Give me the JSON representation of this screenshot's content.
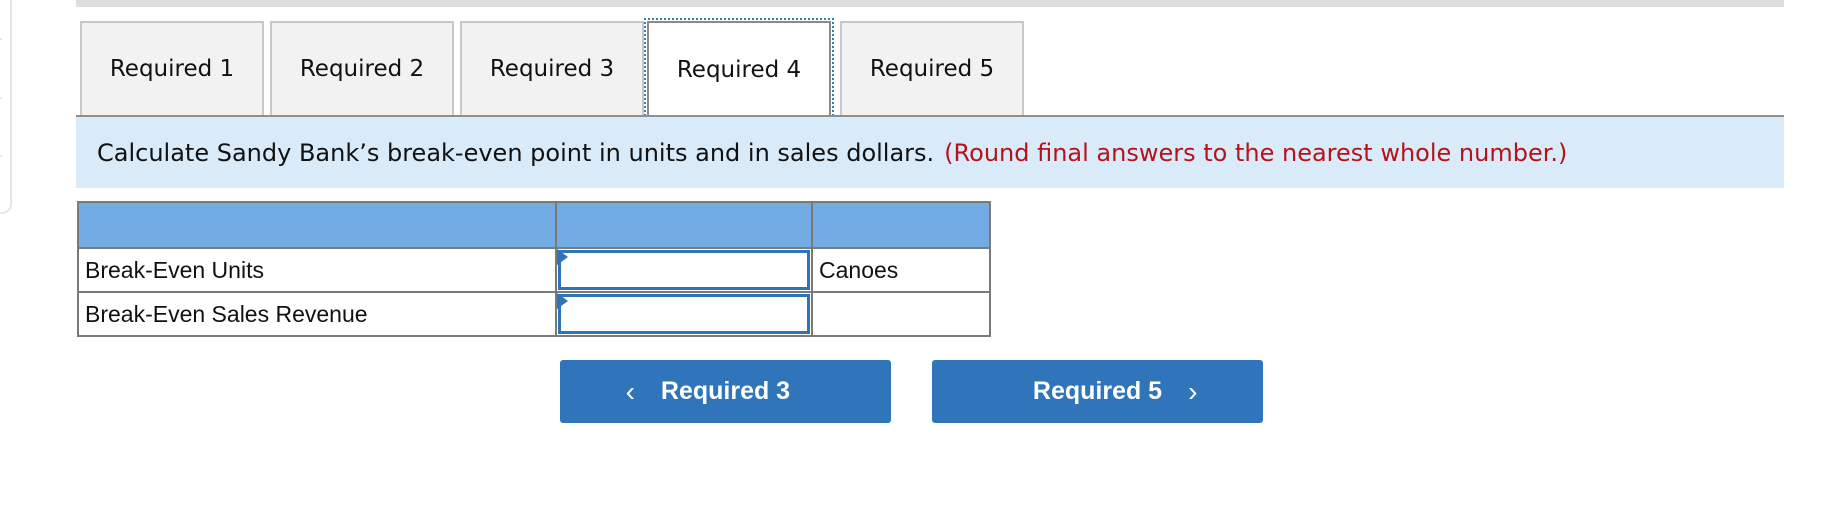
{
  "tabs": [
    {
      "label": "Required 1",
      "active": false
    },
    {
      "label": "Required 2",
      "active": false
    },
    {
      "label": "Required 3",
      "active": false
    },
    {
      "label": "Required 4",
      "active": true
    },
    {
      "label": "Required 5",
      "active": false
    }
  ],
  "instruction": {
    "text": "Calculate Sandy Bank’s break-even point in units and in sales dollars.",
    "note": "(Round final answers to the nearest whole number.)"
  },
  "table": {
    "header": [
      "",
      "",
      ""
    ],
    "rows": [
      {
        "label": "Break-Even Units",
        "value": "",
        "unit": "Canoes"
      },
      {
        "label": "Break-Even Sales Revenue",
        "value": "",
        "unit": ""
      }
    ]
  },
  "nav": {
    "prev_label": "Required 3",
    "next_label": "Required 5",
    "prev_icon": "chevron-left-icon",
    "next_icon": "chevron-right-icon"
  },
  "colors": {
    "accent": "#3075b9",
    "header_blue": "#73ace3",
    "instruction_bg": "#d9ebf9",
    "note_red": "#b5121b"
  }
}
